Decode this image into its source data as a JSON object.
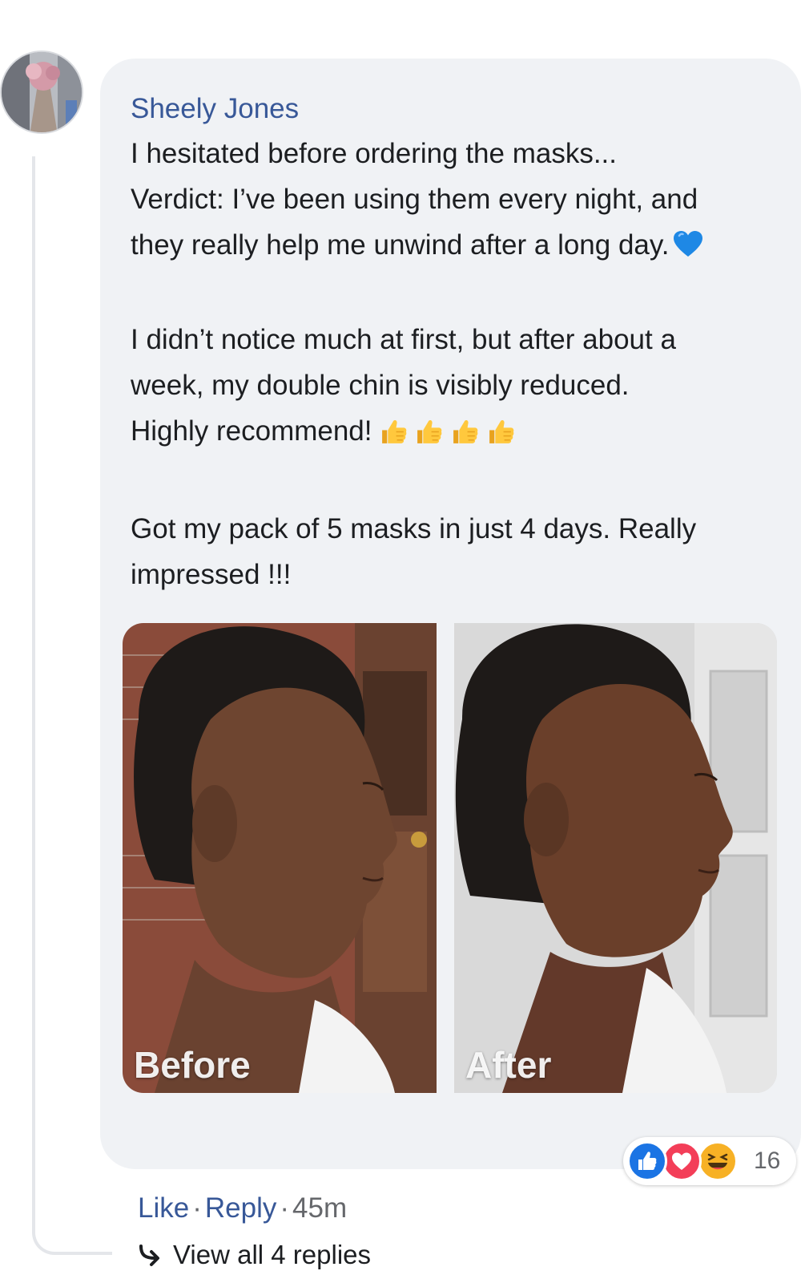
{
  "comment": {
    "author": "Sheely Jones",
    "paragraphs": [
      [
        "I hesitated before ordering the masks...",
        "Verdict: I’ve been using them every night, and",
        "they really help me unwind after a long day."
      ],
      [
        "I didn’t notice much at first, but after about a",
        "week, my double chin is visibly reduced.",
        "Highly recommend!"
      ],
      [
        "Got my pack of 5 masks in just 4 days. Really",
        "impressed !!!"
      ]
    ],
    "emojis": {
      "line1_end": "blue-heart-emoji",
      "line2_end": [
        "thumbs-up-emoji",
        "thumbs-up-emoji",
        "thumbs-up-emoji",
        "thumbs-up-emoji"
      ]
    },
    "photos": [
      {
        "label": "Before"
      },
      {
        "label": "After"
      }
    ],
    "reactions": {
      "icons": [
        "like-icon",
        "love-icon",
        "haha-icon"
      ],
      "count": "16"
    },
    "actions": {
      "like": "Like",
      "separator": "·",
      "reply": "Reply",
      "time": "45m"
    },
    "replies_link": "View all 4 replies"
  },
  "colors": {
    "author_link": "#385898",
    "bubble_bg": "#f0f2f5",
    "like_blue": "#1b74e4",
    "love_red": "#f33e58",
    "haha_yellow": "#f7b125",
    "meta_gray": "#65676b"
  }
}
